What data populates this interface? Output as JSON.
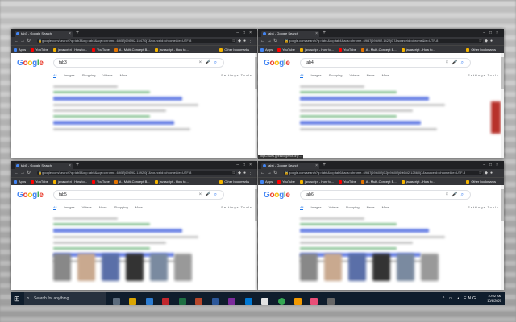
{
  "windows": [
    {
      "tab_title": "tab3 - Google Search",
      "url": "google.com/search?q=tab3&oq=tab3&aqs=chrome..69i57j69i59l2.1547j0j7&sourceid=chrome&ie=UTF-8",
      "query": "tab3",
      "tabs": [
        "All",
        "Images",
        "Shopping",
        "Videos",
        "More"
      ],
      "tools": "Settings   Tools"
    },
    {
      "tab_title": "tab4 - Google Search",
      "url": "google.com/search?q=tab4&oq=tab4&aqs=chrome..69i57j69i59l2.1422j0j7&sourceid=chrome&ie=UTF-8",
      "query": "tab4",
      "tabs": [
        "All",
        "Images",
        "Shopping",
        "Videos",
        "News",
        "More"
      ],
      "tools": "Settings   Tools"
    },
    {
      "tab_title": "tab5 - Google Search",
      "url": "google.com/search?q=tab5&oq=tab5&aqs=chrome..69i57j69i59l2.1392j0j7&sourceid=chrome&ie=UTF-8",
      "query": "tab5",
      "tabs": [
        "All",
        "Images",
        "Videos",
        "News",
        "Shopping",
        "More"
      ],
      "tools": "Settings   Tools"
    },
    {
      "tab_title": "tab6 - Google Search",
      "url": "google.com/search?q=tab6&oq=tab6&aqs=chrome..69i57j69i60l2j0l2j69i60l2j69i65l2.1286j0j7&sourceid=chrome&ie=UTF-8",
      "query": "tab6",
      "tabs": [
        "All",
        "Images",
        "Videos",
        "Shopping",
        "News",
        "More"
      ],
      "tools": "Settings   Tools"
    }
  ],
  "bookmarks": [
    "Apps",
    "YouTube",
    "javascript - How to...",
    "YouTube",
    "A - Multi-Concept B...",
    "javascript - How to..."
  ],
  "bookmark_other": "Other bookmarks",
  "taskbar": {
    "search_placeholder": "Search for anything",
    "time": "10:02 AM",
    "date": "10/6/2020",
    "lang": "ENG"
  },
  "status_tooltip": "https://www.geeksforgeeks.org/...",
  "colors": {
    "google_blue": "#4285f4",
    "google_red": "#ea4335",
    "google_yellow": "#fbbc05",
    "google_green": "#34a853",
    "link": "#1a73e8",
    "chrome_dark": "#202124",
    "taskbar": "#0f1d2c"
  }
}
